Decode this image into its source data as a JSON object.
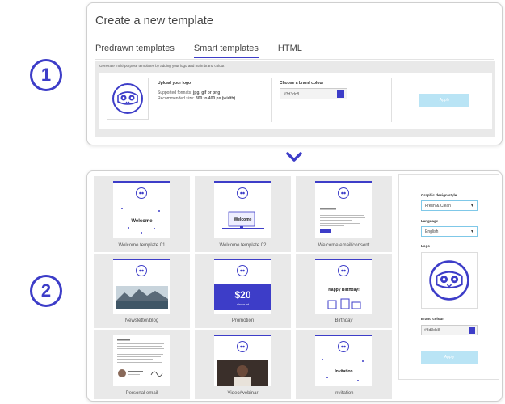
{
  "steps": {
    "one": "1",
    "two": "2"
  },
  "panel1": {
    "title": "Create a new template",
    "tabs": [
      {
        "label": "Predrawn templates",
        "active": false
      },
      {
        "label": "Smart templates",
        "active": true
      },
      {
        "label": "HTML",
        "active": false
      }
    ],
    "description": "Generate multi-purpose templates by adding your logo and main brand colour.",
    "upload": {
      "title": "Upload your logo",
      "formats_prefix": "Supported formats: ",
      "formats_value": "jpg, gif or png",
      "size_prefix": "Recommended size: ",
      "size_value": "300 to 400 px (width)"
    },
    "brand_colour": {
      "title": "Choose a brand colour",
      "value": "#3d3dc8"
    },
    "apply_label": "Apply"
  },
  "templates": [
    {
      "caption": "Welcome template 01",
      "headline": "Welcome"
    },
    {
      "caption": "Welcome template 02",
      "headline": "Welcome"
    },
    {
      "caption": "Welcome email/consent",
      "headline": ""
    },
    {
      "caption": "Newsletter/blog",
      "headline": ""
    },
    {
      "caption": "Promotion",
      "headline": "$20",
      "sub": "discount"
    },
    {
      "caption": "Birthday",
      "headline": "Happy Birthday!"
    },
    {
      "caption": "Personal email",
      "headline": ""
    },
    {
      "caption": "Video/webinar",
      "headline": ""
    },
    {
      "caption": "Invitation",
      "headline": "Invitation"
    }
  ],
  "sidebar": {
    "style_label": "Graphic design style",
    "style_value": "Fresh & Clean",
    "language_label": "Language",
    "language_value": "English",
    "logo_label": "Logo",
    "colour_label": "Brand colour",
    "colour_value": "#3d3dc8",
    "apply_label": "Apply"
  },
  "colors": {
    "accent": "#3d3dc8",
    "apply": "#b9e4f5",
    "tile_bg": "#e9e9e9"
  },
  "icons": {
    "chevron": "chevron-down-icon",
    "logo": "owl-logo-icon"
  }
}
